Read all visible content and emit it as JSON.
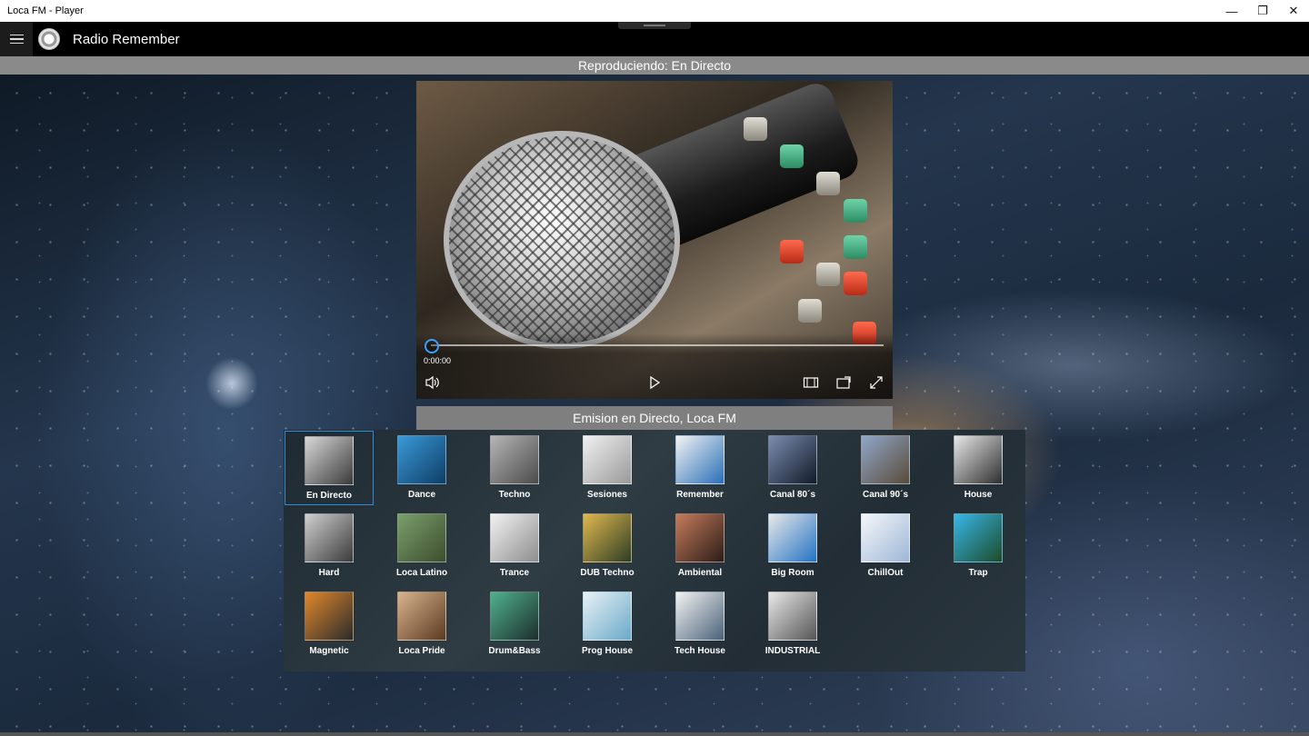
{
  "window": {
    "title": "Loca FM - Player",
    "minimize": "—",
    "restore": "❐",
    "close": "✕"
  },
  "appbar": {
    "title": "Radio Remember"
  },
  "now_playing": "Reproduciendo: En Directo",
  "player": {
    "time": "0:00:00",
    "progress": 0
  },
  "caption": "Emision en Directo, Loca FM",
  "stations": [
    {
      "label": "En Directo",
      "selected": true,
      "c1": "#d8d8d8",
      "c2": "#3a3a3a"
    },
    {
      "label": "Dance",
      "c1": "#3a9ad9",
      "c2": "#0e3d66"
    },
    {
      "label": "Techno",
      "c1": "#b5b5b5",
      "c2": "#4b4b4b"
    },
    {
      "label": "Sesiones",
      "c1": "#f0f0f0",
      "c2": "#9a9a9a"
    },
    {
      "label": "Remember",
      "c1": "#f2f2f2",
      "c2": "#2a6fb7"
    },
    {
      "label": "Canal 80´s",
      "c1": "#7b8cae",
      "c2": "#111a29"
    },
    {
      "label": "Canal 90´s",
      "c1": "#8fa7c9",
      "c2": "#5a4b3a"
    },
    {
      "label": "House",
      "c1": "#e8e8e8",
      "c2": "#2e2e2e"
    },
    {
      "label": "Hard",
      "c1": "#cfcfcf",
      "c2": "#3b3b3b"
    },
    {
      "label": "Loca Latino",
      "c1": "#7a9f6a",
      "c2": "#3e4d30"
    },
    {
      "label": "Trance",
      "c1": "#f1f1f1",
      "c2": "#8e8e8e"
    },
    {
      "label": "DUB Techno",
      "c1": "#e0b84f",
      "c2": "#2e3d24"
    },
    {
      "label": "Ambiental",
      "c1": "#c57b5b",
      "c2": "#2b1c18"
    },
    {
      "label": "Big Room",
      "c1": "#e8e8e8",
      "c2": "#2572c4"
    },
    {
      "label": "ChillOut",
      "c1": "#f5f7fa",
      "c2": "#9db6d6"
    },
    {
      "label": "Trap",
      "c1": "#38b6e8",
      "c2": "#1b4b2a"
    },
    {
      "label": "Magnetic",
      "c1": "#e0872b",
      "c2": "#2b2b2b"
    },
    {
      "label": "Loca Pride",
      "c1": "#d7b48c",
      "c2": "#5b3a22"
    },
    {
      "label": "Drum&Bass",
      "c1": "#4fb08e",
      "c2": "#1d2e2a"
    },
    {
      "label": "Prog House",
      "c1": "#e8f1f5",
      "c2": "#6aa9c9"
    },
    {
      "label": "Tech House",
      "c1": "#f2f2f2",
      "c2": "#4b6279"
    },
    {
      "label": "INDUSTRIAL",
      "c1": "#e8e8e8",
      "c2": "#555555"
    }
  ],
  "colors": {
    "accent": "#2f8cd8",
    "caption_bg": "#7f7f7f"
  }
}
